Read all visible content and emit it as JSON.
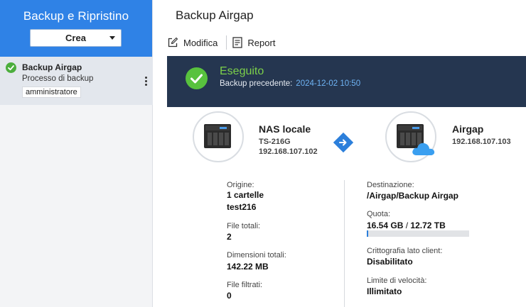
{
  "sidebar": {
    "title": "Backup e Ripristino",
    "create_label": "Crea",
    "job": {
      "title": "Backup Airgap",
      "subtitle": "Processo di backup",
      "tag": "amministratore"
    }
  },
  "main": {
    "title": "Backup Airgap",
    "toolbar": {
      "edit_label": "Modifica",
      "report_label": "Report"
    },
    "banner": {
      "status": "Eseguito",
      "prev_label": "Backup precedente:",
      "prev_date": "2024-12-02 10:50"
    },
    "source_device": {
      "name": "NAS locale",
      "model": "TS-216G",
      "ip": "192.168.107.102"
    },
    "target_device": {
      "name": "Airgap",
      "ip": "192.168.107.103"
    },
    "left_details": {
      "origin_label": "Origine:",
      "origin_value1": "1 cartelle",
      "origin_value2": "test216",
      "files_label": "File totali:",
      "files_value": "2",
      "size_label": "Dimensioni totali:",
      "size_value": "142.22 MB",
      "filtered_label": "File filtrati:",
      "filtered_value": "0"
    },
    "right_details": {
      "dest_label": "Destinazione:",
      "dest_value": "/Airgap/Backup Airgap",
      "quota_label": "Quota:",
      "quota_used": "16.54 GB",
      "quota_sep": "/",
      "quota_total": "12.72 TB",
      "quota_fraction": 0.013,
      "crypto_label": "Crittografia lato client:",
      "crypto_value": "Disabilitato",
      "speed_label": "Limite di velocità:",
      "speed_value": "Illimitato"
    }
  },
  "colors": {
    "accent": "#2f82e6",
    "banner_bg": "#253650",
    "success": "#58c23e",
    "date_link": "#6fb4f5"
  },
  "icons": {
    "job_status": "check-circle-icon",
    "edit": "edit-icon",
    "report": "report-icon",
    "nas": "nas-device-icon",
    "cloud": "cloud-icon",
    "transfer": "arrow-right-icon",
    "menu": "kebab-icon"
  }
}
